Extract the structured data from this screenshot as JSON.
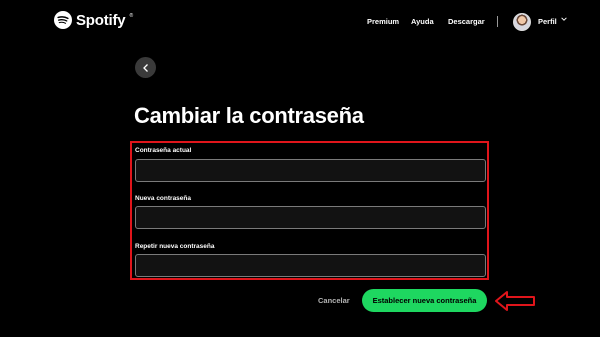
{
  "header": {
    "brand": "Spotify",
    "nav": [
      "Premium",
      "Ayuda",
      "Descargar"
    ],
    "profile_label": "Perfil"
  },
  "page": {
    "title": "Cambiar la contraseña",
    "fields": [
      {
        "label": "Contraseña actual",
        "value": ""
      },
      {
        "label": "Nueva contraseña",
        "value": ""
      },
      {
        "label": "Repetir nueva contraseña",
        "value": ""
      }
    ],
    "cancel_label": "Cancelar",
    "submit_label": "Establecer nueva contraseña"
  },
  "colors": {
    "accent": "#1ed760",
    "highlight": "#e0151b",
    "background": "#000000"
  },
  "icons": [
    "spotify-logo-icon",
    "chevron-down-icon",
    "back-arrow-icon",
    "annotation-arrow-icon"
  ]
}
